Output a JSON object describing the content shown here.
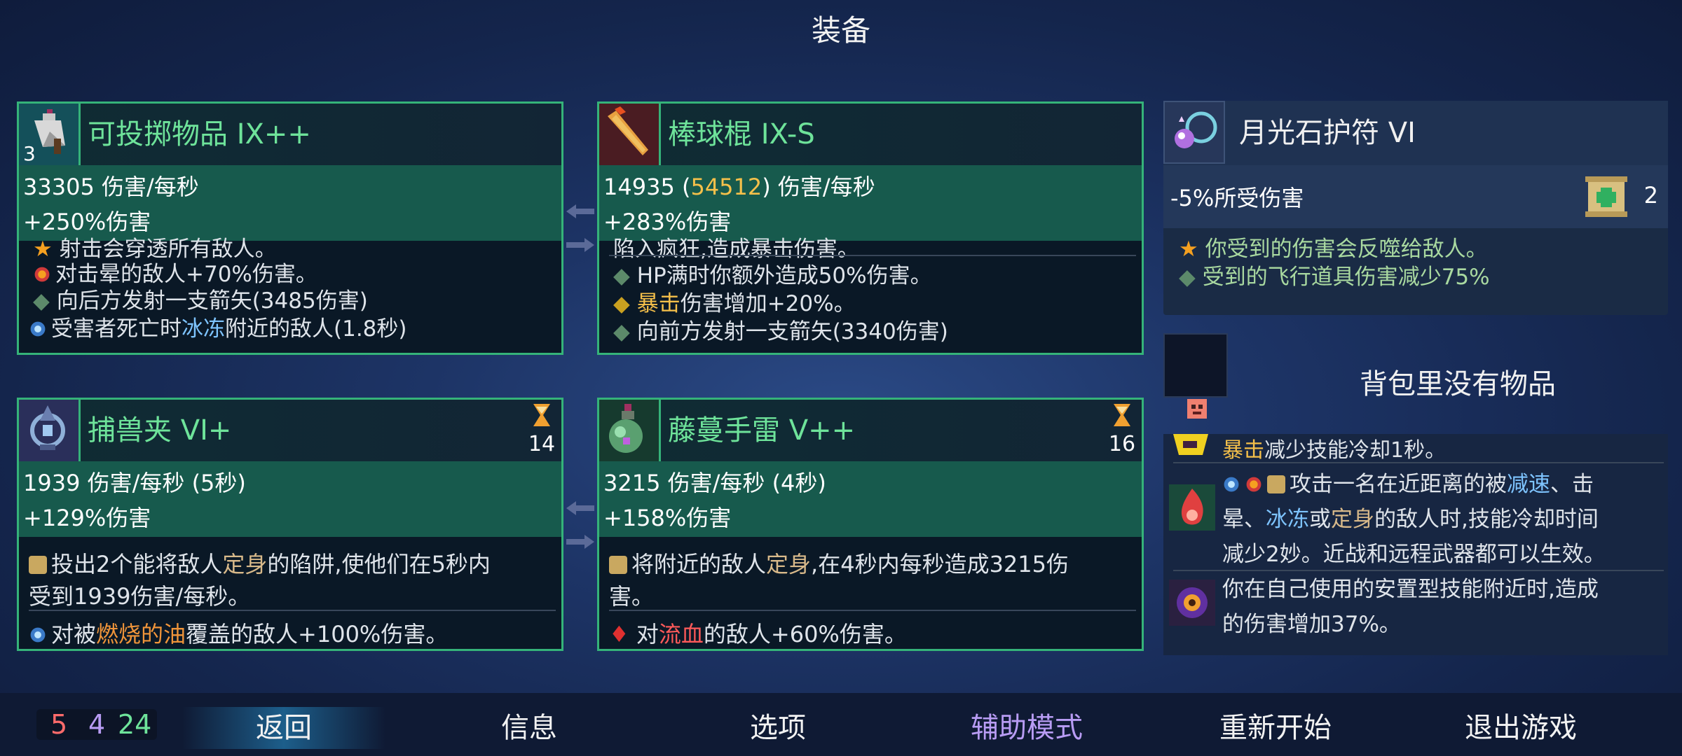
{
  "screen_title": "装备",
  "weapons": [
    {
      "name": "可投掷物品 IX++",
      "level": "3",
      "stat1": "33305 伤害/每秒",
      "stat2": "+250%伤害",
      "clipped_line": "射击会穿透所有敌人。",
      "lines": [
        "对击晕的敌人+70%伤害。",
        "向后方发射一支箭矢(3485伤害)"
      ],
      "line_freeze_pre": "受害者死亡时",
      "line_freeze_hl": "冰冻",
      "line_freeze_post": "附近的敌人(1.8秒)"
    },
    {
      "name": "棒球棍 IX-S",
      "stat1_pre": "14935 (",
      "stat1_hl": "54512",
      "stat1_post": ") 伤害/每秒",
      "stat2": "+283%伤害",
      "clipped_line": "陷入疯狂,造成暴击伤害。",
      "line1": "HP满时你额外造成50%伤害。",
      "line2_hl": "暴击",
      "line2_post": "伤害增加+20%。",
      "line3": "向前方发射一支箭矢(3340伤害)"
    },
    {
      "name": "捕兽夹 VI+",
      "timer": "14",
      "stat1": "1939 伤害/每秒 (5秒)",
      "stat2": "+129%伤害",
      "d1_pre": "投出2个能将敌人",
      "d1_hl": "定身",
      "d1_post": "的陷阱,使他们在5秒内",
      "d2": "受到1939伤害/每秒。",
      "d3_pre": "对被",
      "d3_hl": "燃烧的油",
      "d3_post": "覆盖的敌人+100%伤害。"
    },
    {
      "name": "藤蔓手雷 V++",
      "timer": "16",
      "stat1": "3215 伤害/每秒 (4秒)",
      "stat2": "+158%伤害",
      "d1_pre": "将附近的敌人",
      "d1_hl": "定身",
      "d1_post": ",在4秒内每秒造成3215伤",
      "d2": "害。",
      "d3_pre": "对",
      "d3_hl": "流血",
      "d3_post": "的敌人+60%伤害。"
    }
  ],
  "amulet": {
    "name": "月光石护符 VI",
    "stat": "-5%所受伤害",
    "count": "2",
    "line1": "你受到的伤害会反噬给敌人。",
    "line2": "受到的飞行道具伤害减少75%"
  },
  "backpack": {
    "empty_text": "背包里没有物品",
    "clipped_hl": "暴击",
    "clipped_post": "减少技能冷却1秒。",
    "p1_a": "攻击一名在近距离的被",
    "p1_hl1": "减速",
    "p1_b": "、击",
    "p1_c": "晕、",
    "p1_hl2": "冰冻",
    "p1_d": "或",
    "p1_hl3": "定身",
    "p1_e": "的敌人时,技能冷却时间",
    "p1_f": "减少2妙。近战和远程武器都可以生效。",
    "p2_a": "你在自己使用的安置型技能附近时,造成",
    "p2_b": "的伤害增加37%。"
  },
  "counters": {
    "red": "5",
    "purple": "4",
    "green": "24"
  },
  "menu": [
    "返回",
    "信息",
    "选项",
    "辅助模式",
    "重新开始",
    "退出游戏"
  ],
  "colors": {
    "card_border": "#35b379",
    "weapon_name": "#6ee39a",
    "highlight_yellow": "#f5c04a",
    "highlight_blue": "#7ec4ff",
    "assist_purple": "#b89cf4"
  }
}
